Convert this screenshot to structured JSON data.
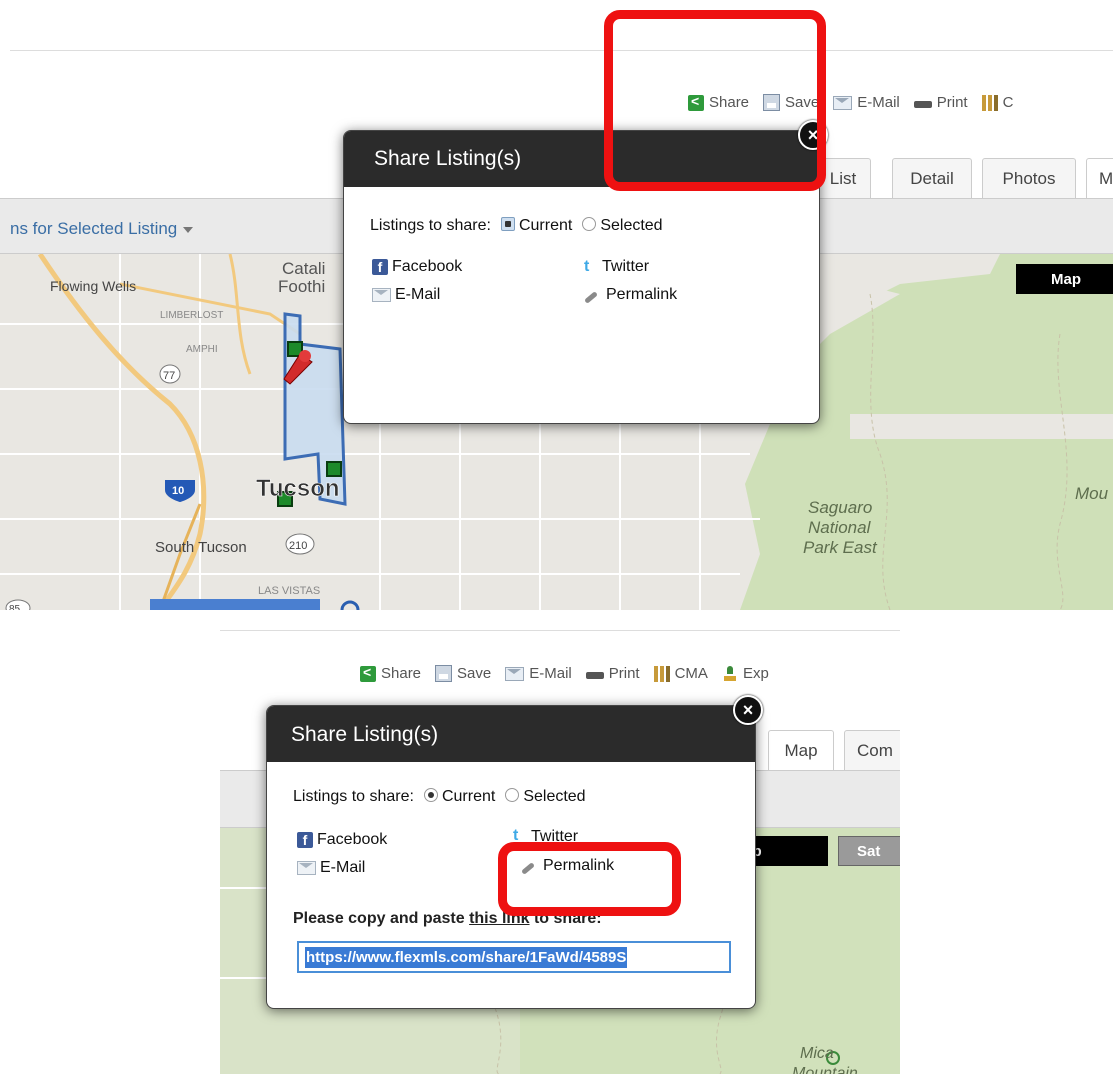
{
  "colors": {
    "highlight": "#ee1111",
    "popup_header": "#2b2b2b",
    "link_color": "#3a6ea5",
    "selection": "#3a7bd5"
  },
  "top": {
    "toolbar": {
      "share": "Share",
      "save": "Save",
      "email": "E-Mail",
      "print": "Print",
      "cma_partial": "C"
    },
    "tabs": [
      "List",
      "Detail",
      "Photos",
      "M"
    ],
    "actions_menu": "ns for Selected Listing",
    "map_type_button": "Map",
    "map_labels": {
      "flowing_wells": "Flowing Wells",
      "catalina": "Catali",
      "foothills": "Foothi",
      "limberlost": "LIMBERLOST",
      "amphi": "AMPHI",
      "tucson": "Tucson",
      "south_tucson": "South Tucson",
      "las_vistas": "LAS VISTAS",
      "saguaro1": "Saguaro",
      "saguaro2": "National",
      "saguaro3": "Park East",
      "mou": "Mou",
      "hwy77": "77",
      "hwy10": "10",
      "hwy210": "210",
      "hwy85": "85"
    },
    "popup": {
      "title": "Share Listing(s)",
      "listings_label": "Listings to share:",
      "current": "Current",
      "selected": "Selected",
      "facebook": "Facebook",
      "twitter": "Twitter",
      "email": "E-Mail",
      "permalink": "Permalink",
      "close_symbol": "×"
    }
  },
  "bottom": {
    "toolbar": {
      "share": "Share",
      "save": "Save",
      "email": "E-Mail",
      "print": "Print",
      "cma": "CMA",
      "export_partial": "Exp"
    },
    "tabs": [
      "Map",
      "Com"
    ],
    "map_buttons": [
      "lap",
      "Sat"
    ],
    "map_labels": {
      "mica1": "Mica",
      "mica2": "Mountain"
    },
    "popup": {
      "title": "Share Listing(s)",
      "listings_label": "Listings to share:",
      "current": "Current",
      "selected": "Selected",
      "facebook": "Facebook",
      "twitter": "Twitter",
      "email": "E-Mail",
      "permalink": "Permalink",
      "copy_prefix": "Please copy and paste ",
      "copy_link": "this link",
      "copy_suffix": " to share:",
      "link_value": "https://www.flexmls.com/share/1FaWd/4589S",
      "close_symbol": "×"
    }
  }
}
